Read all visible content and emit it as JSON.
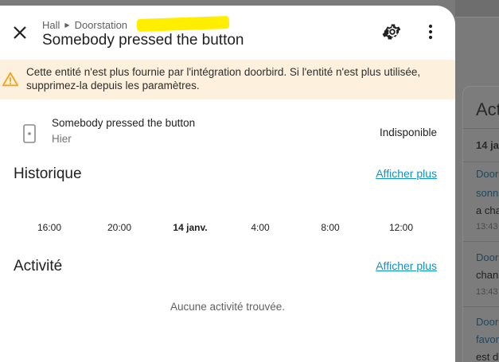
{
  "background": {
    "card_title": "Act",
    "card_date": "14 ja",
    "entries": [
      {
        "line1": "Door",
        "line2": "sonn",
        "line3": "a cha",
        "time": "13:43"
      },
      {
        "line1": "Door",
        "line2": "chan",
        "time": "13:43"
      },
      {
        "line1": "Door",
        "line2": "favor",
        "line3": "est d"
      }
    ]
  },
  "dialog": {
    "breadcrumb": {
      "area": "Hall",
      "device": "Doorstation"
    },
    "title": "Somebody pressed the button",
    "alert": {
      "text": "Cette entité n'est plus fournie par l'intégration doorbird. Si l'entité n'est plus utilisée, supprimez-la depuis les paramètres.",
      "color": "#fdf0dc",
      "icon": "alert-triangle-icon"
    },
    "entity": {
      "name": "Somebody pressed the button",
      "secondary": "Hier",
      "state": "Indisponible",
      "icon": "doorbell-icon"
    },
    "history": {
      "title": "Historique",
      "show_more": "Afficher plus",
      "axis_labels": [
        "16:00",
        "20:00",
        "14 janv.",
        "4:00",
        "8:00",
        "12:00"
      ]
    },
    "activity": {
      "title": "Activité",
      "show_more": "Afficher plus",
      "empty": "Aucune activité trouvée."
    }
  },
  "colors": {
    "accent": "#0e93c3",
    "warning": "#f2a31b",
    "overlay": "#7a7a7a"
  }
}
